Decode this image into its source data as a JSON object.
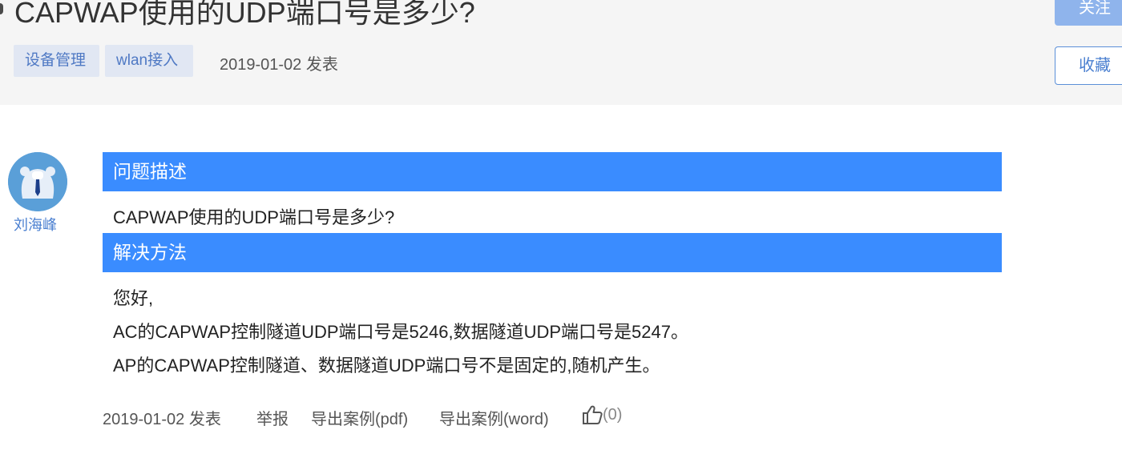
{
  "question": {
    "title": "CAPWAP使用的UDP端口号是多少?",
    "tags": [
      "设备管理",
      "wlan接入"
    ],
    "date_text": "2019-01-02 发表"
  },
  "actions": {
    "follow_label": "关注",
    "collect_label": "收藏"
  },
  "author": {
    "name": "刘海峰"
  },
  "sections": {
    "problem_title": "问题描述",
    "problem_text": "CAPWAP使用的UDP端口号是多少?",
    "solution_title": "解决方法",
    "solution_lines": [
      "您好,",
      "AC的CAPWAP控制隧道UDP端口号是5246,数据隧道UDP端口号是5247。",
      "AP的CAPWAP控制隧道、数据隧道UDP端口号不是固定的,随机产生。"
    ]
  },
  "footer": {
    "date_text": "2019-01-02 发表",
    "report_label": "举报",
    "export_pdf_label": "导出案例(pdf)",
    "export_word_label": "导出案例(word)",
    "like_count": "(0)"
  },
  "colors": {
    "section_bar": "#3a8cff",
    "tag_bg": "#e1e7f3",
    "link": "#4a7fd0"
  }
}
